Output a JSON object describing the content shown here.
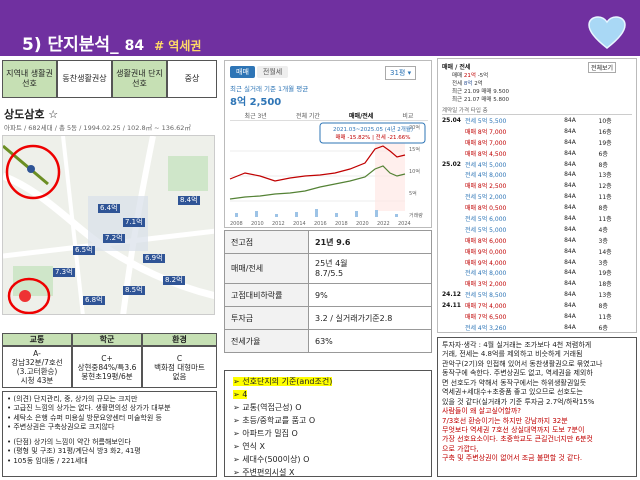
{
  "header": {
    "title": "5) 단지분석_",
    "number": "84",
    "tag": "#  역세권"
  },
  "criteria": {
    "cells": [
      "지역내 생활권 선호",
      "동찬생활권상",
      "생활권내 단지 선호",
      "중상"
    ]
  },
  "complex": {
    "name": "상도삼호 ☆",
    "meta": "아파트 / 682세대 / 총 5동 / 1994.02.25 / 102.8㎡ ~ 136.62㎡"
  },
  "map": {
    "labels": [
      "6.4억",
      "7.1억",
      "7.2억",
      "6.5억",
      "6.9억",
      "8.4억",
      "7.3억",
      "8.2억",
      "8.5억",
      "6.8억"
    ]
  },
  "summary": {
    "headers": [
      "교통",
      "학군",
      "환경"
    ],
    "values": [
      "A-\n강남32분/7호선\n(3.고터환승)\n시청 43분",
      "C+\n상현중84%/특3.6\n봉현초19평/6분",
      "C\n백화점 대형마트\n없음"
    ]
  },
  "notes": [
    "• (의견)  단지관리, 중, 상가의 규모는 크지만",
    "• 고급진 느낌의 상가는 없다. 생활편의성 상가가 대부분",
    "• 세탁소 은행 슈퍼 미용실 방문요양센터 미술학원 등",
    "• 주변상권은 구축상권으로 크지않다",
    "",
    "• (단점) 상가의 느낌이 약간 허름해보인다",
    "• (평형 및 구조) 31평/계단식 방3 화2,  41평",
    "• 105동 임대동 / 221세대"
  ],
  "chart": {
    "tabs": [
      "매매",
      "전월세"
    ],
    "select": "31평",
    "subtitle": "최근 실거래 기준 1개월 평균",
    "price": "8억 2,500",
    "ranges": [
      "최근 3년",
      "전체 기간",
      "매매/전세",
      "비교"
    ],
    "tooltip_line1": "2021.03~2025.05 (4년 2개월)",
    "tooltip_line2": "매매 -15.82%  |  전세 -21.66%",
    "years": [
      "2008",
      "2010",
      "2012",
      "2014",
      "2016",
      "2018",
      "2020",
      "2022",
      "2024"
    ],
    "ylabels": [
      "20억",
      "15억",
      "10억",
      "5억",
      "거래량"
    ]
  },
  "info": {
    "rows": [
      [
        "전고점",
        "21년 9.6"
      ],
      [
        "매매/전세",
        "25년 4월\n8.7/5.5"
      ],
      [
        "고점대비하락률",
        "9%"
      ],
      [
        "투자금",
        "3.2 / 실거래가기준2.8"
      ],
      [
        "전세가율",
        "63%"
      ]
    ]
  },
  "checklist": {
    "items": [
      "➢ 선호단지의 기준(and조건)",
      "➢ 4",
      "➢  교통(역접근성) O",
      "➢  초등/중학교를 품고 O",
      "➢  아파트가 밀집 O",
      "➢  연식 X",
      "➢  세대수(500이상) O",
      "➢  주변편의시설  X"
    ]
  },
  "tx": {
    "header": {
      "title": "매매 / 전세",
      "sel": "전체보기",
      "unit": "계약일  가격  타입  층"
    },
    "stats": [
      [
        "매매",
        "21억",
        "-5억"
      ],
      [
        "전세",
        "8억",
        "2억"
      ],
      [
        "최근",
        "21.09  매매 9.500"
      ],
      [
        "최근",
        "21.07  매매 5.800"
      ]
    ],
    "rows": [
      [
        "25.04",
        "전세",
        "전세 5억 5,500",
        "84A",
        "10층"
      ],
      [
        "",
        "매매",
        "매매 8억 7,000",
        "84A",
        "16층"
      ],
      [
        "",
        "매매",
        "매매 8억 7,000",
        "84A",
        "19층"
      ],
      [
        "",
        "매매",
        "매매 8억 4,500",
        "84A",
        "6층"
      ],
      [
        "25.02",
        "전세",
        "전세 4억 5,000",
        "84A",
        "8층"
      ],
      [
        "",
        "전세",
        "전세 4억 8,000",
        "84A",
        "13층"
      ],
      [
        "",
        "매매",
        "매매 8억 2,500",
        "84A",
        "12층"
      ],
      [
        "",
        "전세",
        "전세 5억 2,000",
        "84A",
        "11층"
      ],
      [
        "",
        "매매",
        "매매 8억 0,500",
        "84A",
        "8층"
      ],
      [
        "",
        "전세",
        "전세 5억 6,000",
        "84A",
        "11층"
      ],
      [
        "",
        "전세",
        "전세 5억 5,000",
        "84A",
        "4층"
      ],
      [
        "",
        "매매",
        "매매 8억 6,000",
        "84A",
        "3층"
      ],
      [
        "",
        "매매",
        "매매 9억 0,000",
        "84A",
        "14층"
      ],
      [
        "",
        "매매",
        "매매 9억 4,000",
        "84A",
        "3층"
      ],
      [
        "",
        "전세",
        "전세 4억 8,000",
        "84A",
        "19층"
      ],
      [
        "",
        "매매",
        "매매 3억 2,000",
        "84A",
        "18층"
      ],
      [
        "24.12",
        "전세",
        "전세 5억 8,500",
        "84A",
        "13층"
      ],
      [
        "24.11",
        "매매",
        "매매 7억 4,000",
        "84A",
        "8층"
      ],
      [
        "",
        "매매",
        "매매 7억 6,500",
        "84A",
        "11층"
      ],
      [
        "",
        "전세",
        "전세 4억 3,260",
        "84A",
        "6층"
      ],
      [
        "",
        "전세",
        "전세 4억 8,000",
        "84A",
        "13층"
      ],
      [
        "",
        "매매",
        "매매 4억 3,250",
        "84A",
        "8층"
      ]
    ]
  },
  "comment": {
    "lines": [
      "투자자·생각 : 4월 실거래는 조가보다 4천 저렴하게",
      "거래, 전세는 4.8억를 제외하고 비슷하게 거래됨",
      "관악구(2기)와 인접해 있어서 동찬생활권으로 묶였고나",
      "동작구에 속한다. 주변상권도 없고, 역세권을 제외하",
      "면 선호도가 약해서 동작구에서는 하위생활권일듯",
      "역세권+세대수+초중품 좋고 있으므로 선호도는",
      "있을 것 같다(실거래가 기준 투자금 2.7억/하락15%"
    ],
    "red": [
      "사람들이 왜 살고싶어할까?",
      "7/3호선 환승이기는 하지만 강남까지 32분",
      "무엇보다 역세권 7호선 상실대역까지 도보 7분이",
      "가장 선호요소이다. 초중학교도 큰길건너지만 6분컷",
      "으로 가깝다,",
      "구축 및 주변상권이 없어서 조금 불편할 것 같다."
    ]
  },
  "colors": {
    "header": "#7030a0",
    "green": "#c6e0b4",
    "sale": "#c00000",
    "rent": "#2e75b6",
    "highlight": "#ffff00"
  }
}
